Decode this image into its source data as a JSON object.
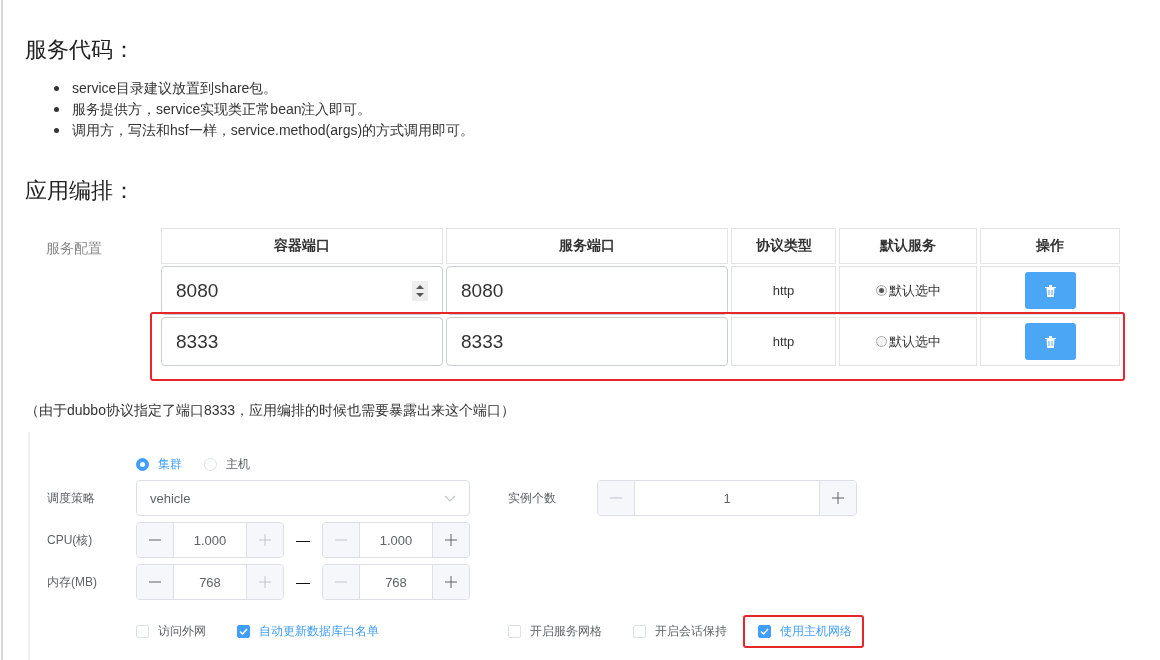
{
  "code_section": {
    "heading": "服务代码：",
    "bullets": [
      "service目录建议放置到share包。",
      "服务提供方，service实现类正常bean注入即可。",
      "调用方，写法和hsf一样，service.method(args)的方式调用即可。"
    ]
  },
  "orchestration": {
    "heading": "应用编排：",
    "service_config": {
      "label": "服务配置",
      "columns": [
        "容器端口",
        "服务端口",
        "协议类型",
        "默认服务",
        "操作"
      ],
      "rows": [
        {
          "container_port": "8080",
          "container_port_hovered": true,
          "service_port": "8080",
          "protocol": "http",
          "default_label": "默认选中",
          "selected": true,
          "highlighted": false
        },
        {
          "container_port": "8333",
          "container_port_hovered": false,
          "service_port": "8333",
          "protocol": "http",
          "default_label": "默认选中",
          "selected": false,
          "highlighted": true
        }
      ]
    }
  },
  "note": "（由于dubbo协议指定了端口8333，应用编排的时候也需要暴露出来这个端口）",
  "deploy_form": {
    "modes": [
      {
        "label": "集群",
        "selected": true
      },
      {
        "label": "主机",
        "selected": false
      }
    ],
    "strategy": {
      "label": "调度策略",
      "value": "vehicle"
    },
    "instances": {
      "label": "实例个数",
      "value": "1",
      "min_disabled": true,
      "max_disabled": false
    },
    "cpu": {
      "label": "CPU(核)",
      "separator": "—",
      "ranges": [
        {
          "value": "1.000",
          "min_disabled": false,
          "max_disabled": true
        },
        {
          "value": "1.000",
          "min_disabled": true,
          "max_disabled": false
        }
      ]
    },
    "memory": {
      "label": "内存(MB)",
      "separator": "—",
      "ranges": [
        {
          "value": "768",
          "min_disabled": false,
          "max_disabled": true
        },
        {
          "value": "768",
          "min_disabled": true,
          "max_disabled": false
        }
      ]
    },
    "options": [
      {
        "label": "访问外网",
        "checked": false,
        "highlighted": false
      },
      {
        "label": "自动更新数据库白名单",
        "checked": true,
        "highlighted": false
      },
      {
        "label": "开启服务网格",
        "checked": false,
        "highlighted": false
      },
      {
        "label": "开启会话保持",
        "checked": false,
        "highlighted": false
      },
      {
        "label": "使用主机网络",
        "checked": true,
        "highlighted": true
      }
    ]
  }
}
